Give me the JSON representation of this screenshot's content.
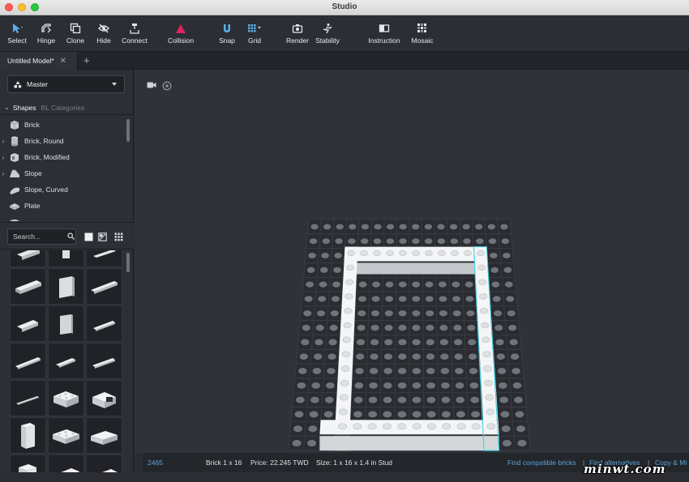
{
  "window": {
    "title": "Studio"
  },
  "toolbar": {
    "items": [
      {
        "label": "Select",
        "icon": "select-cursor-icon"
      },
      {
        "label": "Hinge",
        "icon": "hinge-icon"
      },
      {
        "label": "Clone",
        "icon": "clone-icon"
      },
      {
        "label": "Hide",
        "icon": "hide-eye-icon"
      },
      {
        "label": "Connect",
        "icon": "connect-icon"
      },
      {
        "label": "Collision",
        "icon": "collision-triangle-icon"
      },
      {
        "label": "Snap",
        "icon": "snap-magnet-icon"
      },
      {
        "label": "Grid",
        "icon": "grid-icon"
      },
      {
        "label": "Render",
        "icon": "render-camera-icon"
      },
      {
        "label": "Stability",
        "icon": "stability-icon"
      },
      {
        "label": "Instruction",
        "icon": "instruction-book-icon"
      },
      {
        "label": "Mosaic",
        "icon": "mosaic-icon"
      }
    ],
    "accent_collision": "#e0245e",
    "accent_active": "#5ab1e8"
  },
  "tabs": {
    "active": "Untitled Model*",
    "add": "+",
    "close": "✕"
  },
  "palette": {
    "master_label": "Master",
    "tab_shapes": "Shapes",
    "tab_categories": "BL Categories",
    "categories": [
      {
        "label": "Brick",
        "expandable": false
      },
      {
        "label": "Brick, Round",
        "expandable": true
      },
      {
        "label": "Brick, Modified",
        "expandable": true
      },
      {
        "label": "Slope",
        "expandable": true
      },
      {
        "label": "Slope, Curved",
        "expandable": false
      },
      {
        "label": "Plate",
        "expandable": false
      }
    ],
    "search_placeholder": "Search..."
  },
  "status": {
    "part_id": "2465",
    "part_name": "Brick 1 x 16",
    "price": "Price: 22.245 TWD",
    "size": "Size: 1 x 16 x 1.4 in Stud",
    "link_compatible": "Find compatible bricks",
    "separator": "|",
    "link_alternatives": "Find alternatives",
    "link_copy": "Copy & Mi"
  },
  "watermark": "minwt.com"
}
